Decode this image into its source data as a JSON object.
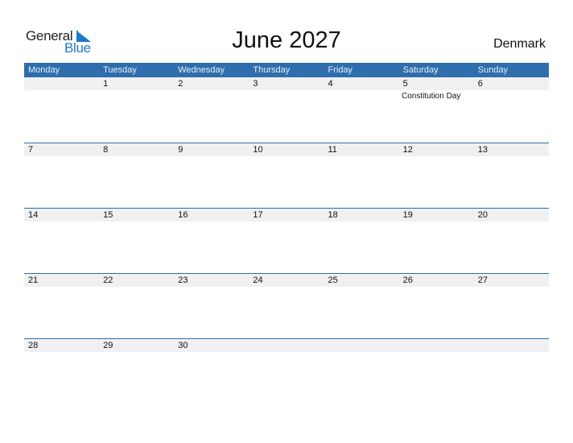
{
  "logo": {
    "line1": "General",
    "line2": "Blue",
    "brand_color": "#1f78c8"
  },
  "title": "June 2027",
  "country": "Denmark",
  "header_color": "#2e6ead",
  "days_of_week": [
    "Monday",
    "Tuesday",
    "Wednesday",
    "Thursday",
    "Friday",
    "Saturday",
    "Sunday"
  ],
  "weeks": [
    [
      "",
      "1",
      "2",
      "3",
      "4",
      "5",
      "6"
    ],
    [
      "7",
      "8",
      "9",
      "10",
      "11",
      "12",
      "13"
    ],
    [
      "14",
      "15",
      "16",
      "17",
      "18",
      "19",
      "20"
    ],
    [
      "21",
      "22",
      "23",
      "24",
      "25",
      "26",
      "27"
    ],
    [
      "28",
      "29",
      "30",
      "",
      "",
      "",
      ""
    ]
  ],
  "holidays": [
    {
      "date": "5",
      "name": "Constitution Day"
    }
  ]
}
